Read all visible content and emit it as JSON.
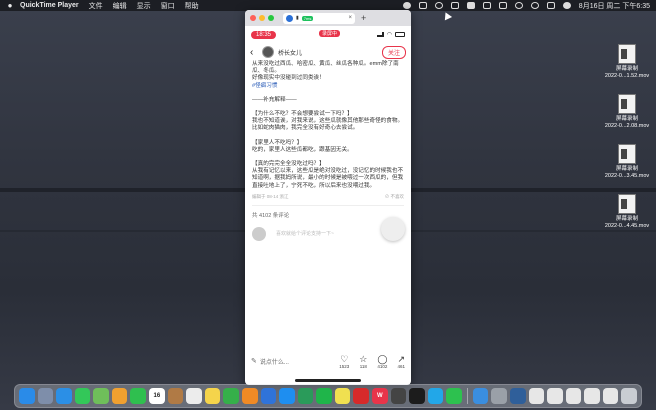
{
  "menubar": {
    "app_name": "QuickTime Player",
    "menus": [
      "文件",
      "编辑",
      "显示",
      "窗口",
      "帮助"
    ],
    "clock": "8月16日 周二 下午6:35"
  },
  "browser_tab": {
    "badge": "7ms",
    "add": "+"
  },
  "phone_status": {
    "time": "18:35",
    "recording": "录屏中"
  },
  "post": {
    "author": "桥长女儿",
    "follow_label": "关注",
    "paragraphs": [
      "从来没吃过西瓜、哈密瓜、黄瓜、丝瓜各种瓜。emm除了南瓜、冬瓜。",
      "好像现实中没碰到过同类诶！",
      "——补充解释——",
      "【为什么不吃？不会想要尝试一下吗？】\n我也不知道诶，对我来说，这些瓜就像其他那些奇怪的食物。比如蛇肉猫肉，我完全没有好奇心去尝试。",
      "【家里人不吃吗？】\n吃的，家里人这些瓜都吃，跟基因无关。",
      "【真的完完全全没吃过吗？】\n从我有记忆以来，这些瓜是绝对没吃过，没记忆的时候我也不知道啊，据我妈所说，最小的时候是被喂过一次西瓜的，但我直接吐地上了，宁死不吃，所以后来也没喂过我。"
    ],
    "hashtag": "#怪癖习惯",
    "edited": "编辑于 08-14 浙江",
    "dislike": "不喜欢",
    "comment_count": "共 4102 条评论",
    "comment_placeholder": "喜欢就给个评论支持一下~",
    "say_something": "说点什么...",
    "actions": [
      {
        "icon": "heart-icon",
        "glyph": "♡",
        "count": "1523"
      },
      {
        "icon": "star-icon",
        "glyph": "☆",
        "count": "118"
      },
      {
        "icon": "comment-icon",
        "glyph": "◯",
        "count": "4102"
      },
      {
        "icon": "share-icon",
        "glyph": "↗",
        "count": "461"
      }
    ]
  },
  "desktop_files": [
    {
      "name": "屏幕录制",
      "sub": "2022-0...1.52.mov"
    },
    {
      "name": "屏幕录制",
      "sub": "2022-0...2.08.mov"
    },
    {
      "name": "屏幕录制",
      "sub": "2022-0...3.45.mov"
    },
    {
      "name": "屏幕录制",
      "sub": "2022-0...4.45.mov"
    }
  ],
  "dock": {
    "calendar_day": "16",
    "apps": [
      {
        "name": "finder",
        "color": "#2a8be8",
        "label": ""
      },
      {
        "name": "launchpad",
        "color": "#7e8eaa",
        "label": ""
      },
      {
        "name": "safari",
        "color": "#2b8fe6",
        "label": ""
      },
      {
        "name": "messages",
        "color": "#33c759",
        "label": ""
      },
      {
        "name": "maps",
        "color": "#6fbf5a",
        "label": ""
      },
      {
        "name": "photos",
        "color": "#f0a030",
        "label": ""
      },
      {
        "name": "facetime",
        "color": "#2fbf4f",
        "label": ""
      },
      {
        "name": "calendar",
        "color": "#ffffff",
        "label": "16"
      },
      {
        "name": "notes-brown",
        "color": "#b07a45",
        "label": ""
      },
      {
        "name": "reminders",
        "color": "#ececec",
        "label": ""
      },
      {
        "name": "notes",
        "color": "#f5d44b",
        "label": ""
      },
      {
        "name": "numbers",
        "color": "#35b04a",
        "label": ""
      },
      {
        "name": "pages",
        "color": "#f08a25",
        "label": ""
      },
      {
        "name": "keynote",
        "color": "#2f73d9",
        "label": ""
      },
      {
        "name": "app-store",
        "color": "#1e8ef0",
        "label": ""
      },
      {
        "name": "wechat-work",
        "color": "#2a9b5a",
        "label": ""
      },
      {
        "name": "iqiyi",
        "color": "#1fb54a",
        "label": ""
      },
      {
        "name": "weather",
        "color": "#f0e050",
        "label": ""
      },
      {
        "name": "netease-music",
        "color": "#d62a2a",
        "label": ""
      },
      {
        "name": "wps",
        "color": "#e8344a",
        "label": "W"
      },
      {
        "name": "chatgpt",
        "color": "#444444",
        "label": ""
      },
      {
        "name": "terminal",
        "color": "#1c1c1c",
        "label": ""
      },
      {
        "name": "qq",
        "color": "#22a7e8",
        "label": ""
      },
      {
        "name": "wechat",
        "color": "#2dc14f",
        "label": ""
      },
      {
        "name": "sep",
        "color": "",
        "label": ""
      },
      {
        "name": "preview",
        "color": "#3a8ee0",
        "label": ""
      },
      {
        "name": "sysprefs",
        "color": "#9aa0a8",
        "label": ""
      },
      {
        "name": "quicktime",
        "color": "#2f5f9a",
        "label": ""
      },
      {
        "name": "doc1",
        "color": "#e7e7e7",
        "label": ""
      },
      {
        "name": "doc2",
        "color": "#e7e7e7",
        "label": ""
      },
      {
        "name": "doc3",
        "color": "#e7e7e7",
        "label": ""
      },
      {
        "name": "doc4",
        "color": "#e7e7e7",
        "label": ""
      },
      {
        "name": "doc5",
        "color": "#e7e7e7",
        "label": ""
      },
      {
        "name": "trash",
        "color": "#c9cdd3",
        "label": ""
      }
    ]
  }
}
